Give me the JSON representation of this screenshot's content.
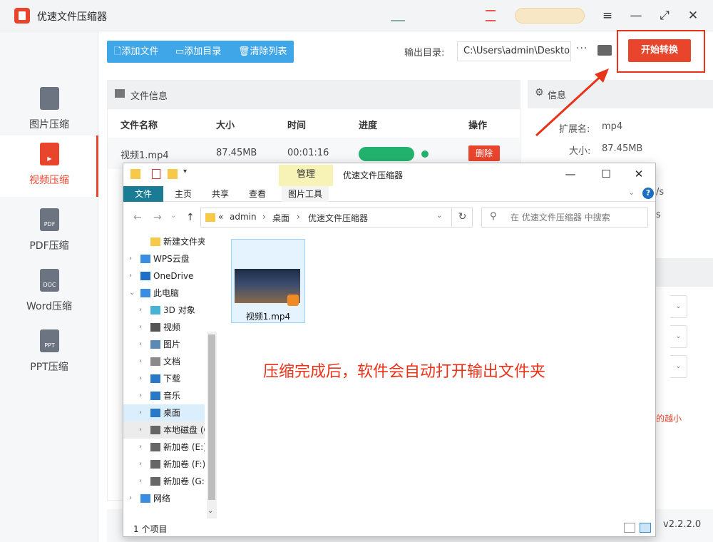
{
  "app": {
    "title": "优速文件压缩器"
  },
  "toolbar": {
    "add_file": "添加文件",
    "add_dir": "添加目录",
    "clear_list": "清除列表"
  },
  "output": {
    "label": "输出目录:",
    "path": "C:\\Users\\admin\\Deskto",
    "more": "···"
  },
  "start_button": "开始转换",
  "sidebar": {
    "items": [
      {
        "label": "图片压缩",
        "icon": "image-file-icon",
        "badge": "",
        "active": false
      },
      {
        "label": "视频压缩",
        "icon": "video-file-icon",
        "badge": "",
        "active": true
      },
      {
        "label": "PDF压缩",
        "icon": "pdf-file-icon",
        "badge": "PDF",
        "active": false
      },
      {
        "label": "Word压缩",
        "icon": "doc-file-icon",
        "badge": "DOC",
        "active": false
      },
      {
        "label": "PPT压缩",
        "icon": "ppt-file-icon",
        "badge": "PPT",
        "active": false
      }
    ]
  },
  "file_panel": {
    "title": "文件信息",
    "columns": [
      "文件名称",
      "大小",
      "时间",
      "进度",
      "操作"
    ],
    "rows": [
      {
        "name": "视频1.mp4",
        "size": "87.45MB",
        "time": "00:01:16",
        "progress": 1.0,
        "action": "删除"
      }
    ]
  },
  "info_panel": {
    "title": "信息",
    "ext_label": "扩展名:",
    "ext_value": "mp4",
    "size_label": "大小:",
    "size_value": "87.45MB",
    "partial_1": "/s",
    "partial_2": "s",
    "hint_partial": "的越小"
  },
  "version": "v2.2.2.0",
  "explorer": {
    "title": "优速文件压缩器",
    "manage_tab": "管理",
    "tabs": [
      "文件",
      "主页",
      "共享",
      "查看",
      "图片工具"
    ],
    "address": [
      "«",
      "admin",
      "›",
      "桌面",
      "›",
      "优速文件压缩器"
    ],
    "search_placeholder": "在 优速文件压缩器 中搜索",
    "tree": [
      {
        "label": "新建文件夹",
        "icon": "folder-icon",
        "chev": ""
      },
      {
        "label": "WPS云盘",
        "icon": "cloud-icon",
        "chev": "›"
      },
      {
        "label": "OneDrive",
        "icon": "onedrive-icon",
        "chev": "›"
      },
      {
        "label": "此电脑",
        "icon": "computer-icon",
        "chev": "⌄"
      },
      {
        "label": "3D 对象",
        "icon": "cube-icon",
        "chev": "›"
      },
      {
        "label": "视频",
        "icon": "video-icon",
        "chev": "›"
      },
      {
        "label": "图片",
        "icon": "picture-icon",
        "chev": "›"
      },
      {
        "label": "文档",
        "icon": "document-icon",
        "chev": "›"
      },
      {
        "label": "下载",
        "icon": "download-icon",
        "chev": "›"
      },
      {
        "label": "音乐",
        "icon": "music-icon",
        "chev": "›"
      },
      {
        "label": "桌面",
        "icon": "desktop-icon",
        "chev": "›"
      },
      {
        "label": "本地磁盘 (C",
        "icon": "drive-icon",
        "chev": "›"
      },
      {
        "label": "新加卷 (E:)",
        "icon": "drive-icon",
        "chev": "›"
      },
      {
        "label": "新加卷 (F:)",
        "icon": "drive-icon",
        "chev": "›"
      },
      {
        "label": "新加卷 (G:)",
        "icon": "drive-icon",
        "chev": "›"
      },
      {
        "label": "网络",
        "icon": "network-icon",
        "chev": "›"
      }
    ],
    "file": {
      "name": "视频1.mp4",
      "icon": "video-thumbnail-icon"
    },
    "status": "1 个项目"
  },
  "annotation": "压缩完成后，软件会自动打开输出文件夹",
  "colors": {
    "accent": "#e8452c",
    "toolbar": "#3fa6e8",
    "progress": "#23b26d",
    "ribbon_file": "#1a7c94"
  }
}
